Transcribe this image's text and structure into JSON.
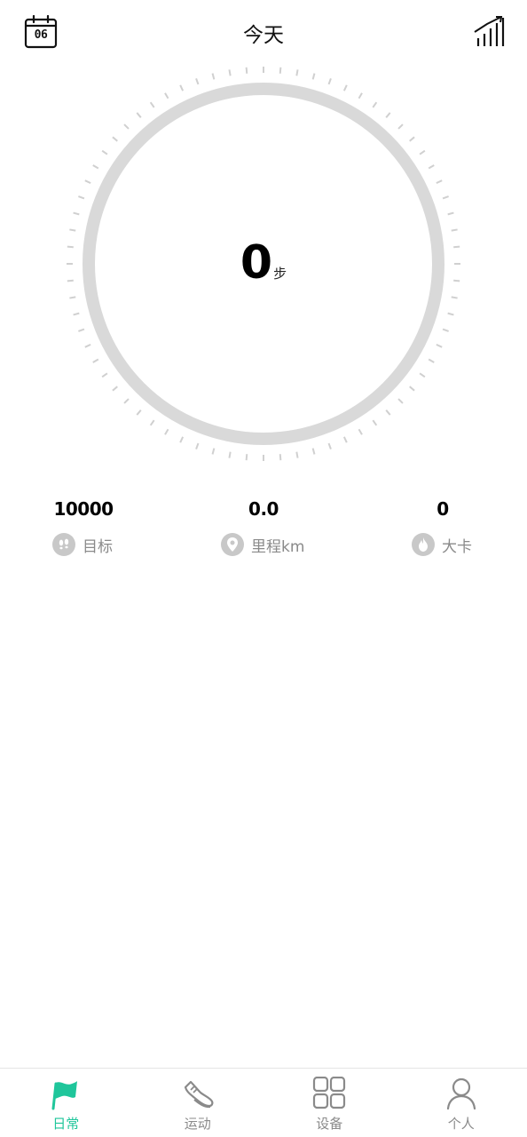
{
  "header": {
    "calendar_day": "06",
    "title": "今天"
  },
  "progress": {
    "steps": "0",
    "unit": "步",
    "goal_fraction": 0
  },
  "metrics": [
    {
      "value": "10000",
      "label": "目标",
      "icon": "footprints-icon"
    },
    {
      "value": "0.0",
      "label": "里程km",
      "icon": "location-pin-icon"
    },
    {
      "value": "0",
      "label": "大卡",
      "icon": "flame-icon"
    }
  ],
  "tabs": [
    {
      "label": "日常",
      "icon": "flag-icon",
      "active": true
    },
    {
      "label": "运动",
      "icon": "sneaker-icon",
      "active": false
    },
    {
      "label": "设备",
      "icon": "grid-icon",
      "active": false
    },
    {
      "label": "个人",
      "icon": "person-icon",
      "active": false
    }
  ],
  "colors": {
    "accent": "#1fc69b",
    "ring": "#d9d9d9",
    "tick": "#d0d0d0",
    "inactive": "#8a8a8a"
  }
}
